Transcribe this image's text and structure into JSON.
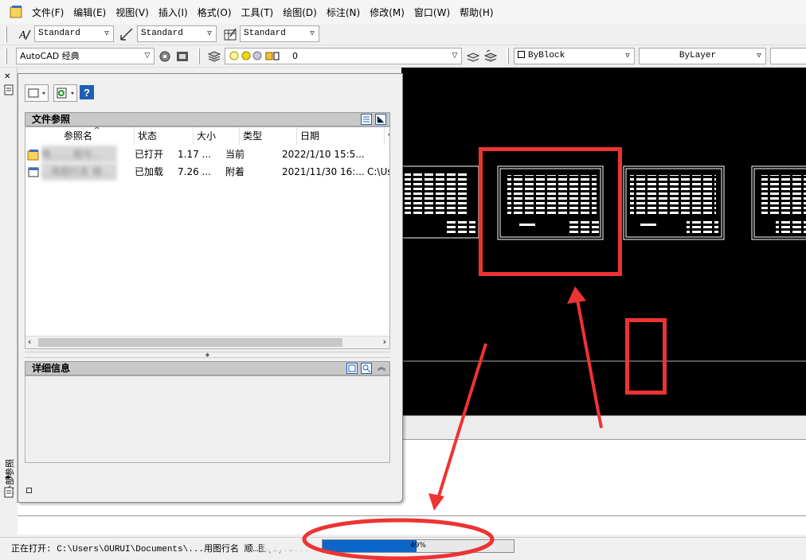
{
  "menubar": {
    "items": [
      "文件(F)",
      "编辑(E)",
      "视图(V)",
      "插入(I)",
      "格式(O)",
      "工具(T)",
      "绘图(D)",
      "标注(N)",
      "修改(M)",
      "窗口(W)",
      "帮助(H)"
    ]
  },
  "toolbar1": {
    "text_style": "Standard",
    "dim_style": "Standard",
    "table_style": "Standard"
  },
  "toolbar2": {
    "workspace": "AutoCAD 经典",
    "layer": "0",
    "color": "ByBlock",
    "linetype": "ByLayer"
  },
  "palette": {
    "strip_label": "外部参照",
    "file_refs_title": "文件参照",
    "columns": [
      "参照名",
      "状态",
      "大小",
      "类型",
      "日期",
      "保"
    ],
    "rows": [
      {
        "name": "电…… 图与…",
        "status": "已打开",
        "size": "1.17 ...",
        "type": "当前",
        "date": "2022/1/10 15:5...",
        "path": ""
      },
      {
        "name": "…用图行名 顺…",
        "status": "已加载",
        "size": "7.26 ...",
        "type": "附着",
        "date": "2021/11/30 16:...",
        "path": "C:\\Us"
      }
    ],
    "details_title": "详细信息"
  },
  "status": {
    "text": "正在打开: C:\\Users\\OURUI\\Documents\\...用图行名 顺…图(1).d...",
    "progress_pct": 0.49,
    "progress_label": "49%"
  },
  "colors": {
    "annotation_red": "#ee3333",
    "progress_blue": "#0a66c8"
  }
}
